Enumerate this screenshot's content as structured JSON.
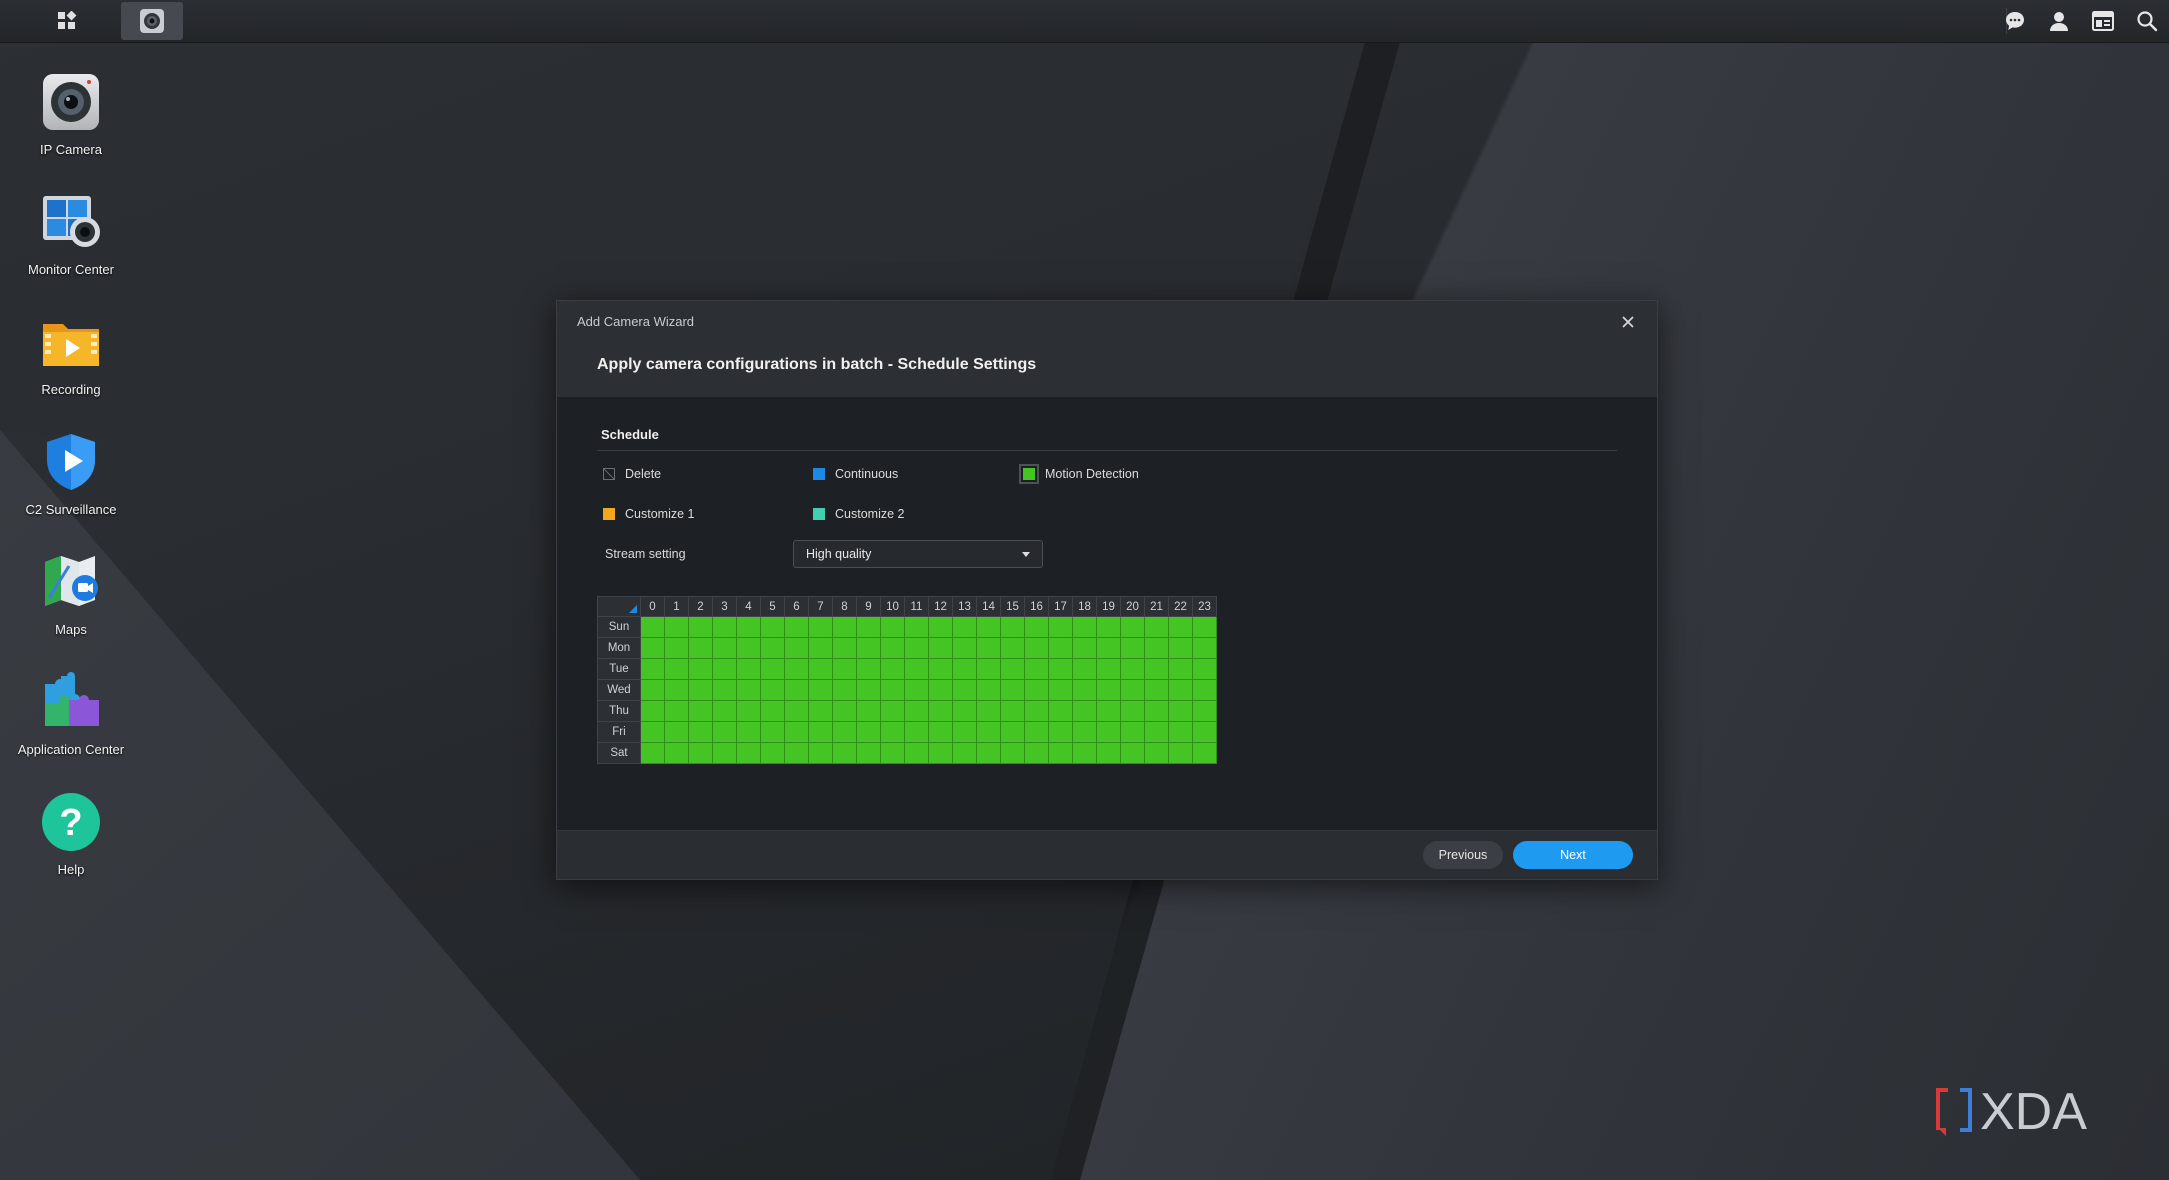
{
  "desktop": {
    "icons": [
      {
        "label": "IP Camera"
      },
      {
        "label": "Monitor Center"
      },
      {
        "label": "Recording"
      },
      {
        "label": "C2 Surveillance"
      },
      {
        "label": "Maps"
      },
      {
        "label": "Application Center"
      },
      {
        "label": "Help"
      }
    ]
  },
  "taskbar": {
    "main_menu_icon": "grid-menu-icon",
    "open_app_icon": "camera-icon",
    "right_icons": [
      "chat-icon",
      "user-icon",
      "widgets-icon",
      "search-icon"
    ]
  },
  "dialog": {
    "window_title": "Add Camera Wizard",
    "heading": "Apply camera configurations in batch - Schedule Settings",
    "section_title": "Schedule",
    "legend": [
      {
        "label": "Delete",
        "color": "transparent"
      },
      {
        "label": "Continuous",
        "color": "#1e88e5"
      },
      {
        "label": "Motion Detection",
        "color": "#44c523",
        "selected": true
      },
      {
        "label": "Customize 1",
        "color": "#f0a81e"
      },
      {
        "label": "Customize 2",
        "color": "#3fd0b0"
      }
    ],
    "stream_setting": {
      "label": "Stream setting",
      "value": "High quality"
    },
    "schedule": {
      "hours": [
        "0",
        "1",
        "2",
        "3",
        "4",
        "5",
        "6",
        "7",
        "8",
        "9",
        "10",
        "11",
        "12",
        "13",
        "14",
        "15",
        "16",
        "17",
        "18",
        "19",
        "20",
        "21",
        "22",
        "23"
      ],
      "days": [
        "Sun",
        "Mon",
        "Tue",
        "Wed",
        "Thu",
        "Fri",
        "Sat"
      ],
      "fill_mode": "Motion Detection",
      "fill_color": "#44c523"
    },
    "buttons": {
      "previous": "Previous",
      "next": "Next"
    }
  },
  "watermark": {
    "text": "XDA"
  },
  "colors": {
    "accent": "#1e9bf0",
    "motion": "#44c523"
  }
}
